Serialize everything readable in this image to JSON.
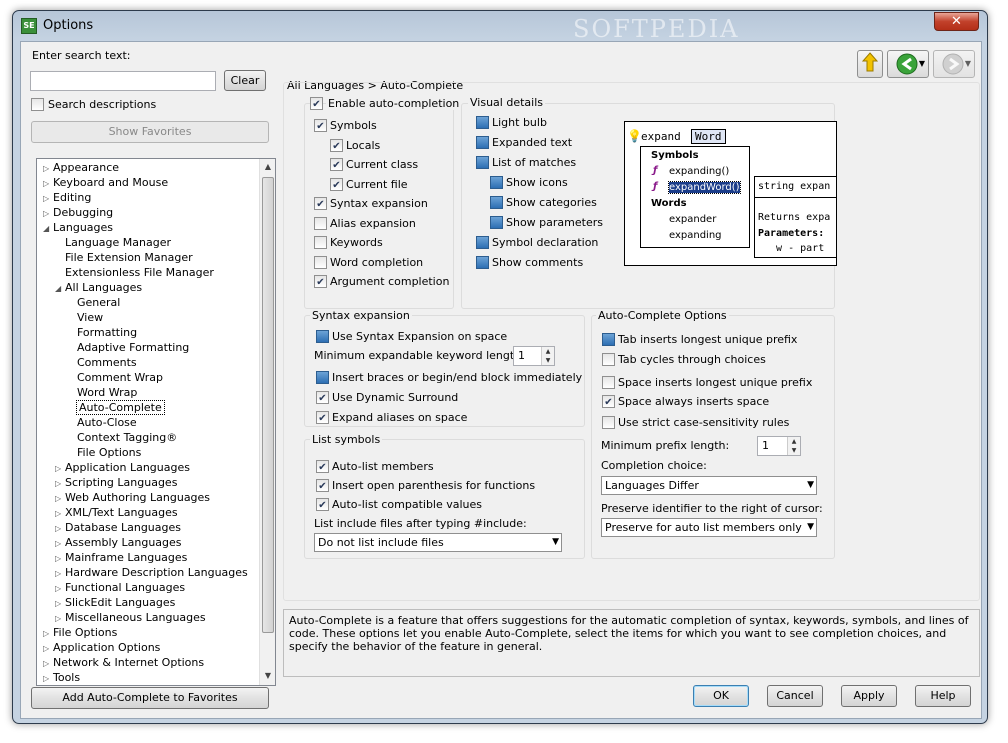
{
  "window": {
    "title": "Options",
    "app_icon": "SE",
    "watermark": "SOFTPEDIA",
    "close_glyph": "✕"
  },
  "left": {
    "search_label": "Enter search text:",
    "search_value": "",
    "clear_label": "Clear",
    "search_desc_label": "Search descriptions",
    "show_favorites_label": "Show Favorites",
    "add_favorites_label": "Add Auto-Complete to Favorites"
  },
  "tree": [
    {
      "label": "Appearance",
      "indent": 0,
      "twisty": "▷"
    },
    {
      "label": "Keyboard and Mouse",
      "indent": 0,
      "twisty": "▷"
    },
    {
      "label": "Editing",
      "indent": 0,
      "twisty": "▷"
    },
    {
      "label": "Debugging",
      "indent": 0,
      "twisty": "▷"
    },
    {
      "label": "Languages",
      "indent": 0,
      "twisty": "◢"
    },
    {
      "label": "Language Manager",
      "indent": 1,
      "twisty": ""
    },
    {
      "label": "File Extension Manager",
      "indent": 1,
      "twisty": ""
    },
    {
      "label": "Extensionless File Manager",
      "indent": 1,
      "twisty": ""
    },
    {
      "label": "All Languages",
      "indent": 1,
      "twisty": "◢"
    },
    {
      "label": "General",
      "indent": 2,
      "twisty": ""
    },
    {
      "label": "View",
      "indent": 2,
      "twisty": ""
    },
    {
      "label": "Formatting",
      "indent": 2,
      "twisty": ""
    },
    {
      "label": "Adaptive Formatting",
      "indent": 2,
      "twisty": ""
    },
    {
      "label": "Comments",
      "indent": 2,
      "twisty": ""
    },
    {
      "label": "Comment Wrap",
      "indent": 2,
      "twisty": ""
    },
    {
      "label": "Word Wrap",
      "indent": 2,
      "twisty": ""
    },
    {
      "label": "Auto-Complete",
      "indent": 2,
      "twisty": "",
      "selected": true
    },
    {
      "label": "Auto-Close",
      "indent": 2,
      "twisty": ""
    },
    {
      "label": "Context Tagging®",
      "indent": 2,
      "twisty": ""
    },
    {
      "label": "File Options",
      "indent": 2,
      "twisty": ""
    },
    {
      "label": "Application Languages",
      "indent": 1,
      "twisty": "▷"
    },
    {
      "label": "Scripting Languages",
      "indent": 1,
      "twisty": "▷"
    },
    {
      "label": "Web Authoring Languages",
      "indent": 1,
      "twisty": "▷"
    },
    {
      "label": "XML/Text Languages",
      "indent": 1,
      "twisty": "▷"
    },
    {
      "label": "Database Languages",
      "indent": 1,
      "twisty": "▷"
    },
    {
      "label": "Assembly Languages",
      "indent": 1,
      "twisty": "▷"
    },
    {
      "label": "Mainframe Languages",
      "indent": 1,
      "twisty": "▷"
    },
    {
      "label": "Hardware Description Languages",
      "indent": 1,
      "twisty": "▷"
    },
    {
      "label": "Functional Languages",
      "indent": 1,
      "twisty": "▷"
    },
    {
      "label": "SlickEdit Languages",
      "indent": 1,
      "twisty": "▷"
    },
    {
      "label": "Miscellaneous Languages",
      "indent": 1,
      "twisty": "▷"
    },
    {
      "label": "File Options",
      "indent": 0,
      "twisty": "▷"
    },
    {
      "label": "Application Options",
      "indent": 0,
      "twisty": "▷"
    },
    {
      "label": "Network & Internet Options",
      "indent": 0,
      "twisty": "▷"
    },
    {
      "label": "Tools",
      "indent": 0,
      "twisty": "▷"
    }
  ],
  "breadcrumb": "All Languages > Auto-Complete",
  "enable": {
    "label": "Enable auto-completion",
    "checked": true
  },
  "enable_items": [
    {
      "label": "Symbols",
      "checked": true,
      "indent": 0
    },
    {
      "label": "Locals",
      "checked": true,
      "indent": 1
    },
    {
      "label": "Current class",
      "checked": true,
      "indent": 1
    },
    {
      "label": "Current file",
      "checked": true,
      "indent": 1
    },
    {
      "label": "Syntax expansion",
      "checked": true,
      "indent": 0
    },
    {
      "label": "Alias expansion",
      "checked": false,
      "indent": 0
    },
    {
      "label": "Keywords",
      "checked": false,
      "indent": 0
    },
    {
      "label": "Word completion",
      "checked": false,
      "indent": 0
    },
    {
      "label": "Argument completion",
      "checked": true,
      "indent": 0
    }
  ],
  "visual": {
    "title": "Visual details",
    "items": [
      {
        "label": "Light bulb",
        "indent": 0
      },
      {
        "label": "Expanded text",
        "indent": 0
      },
      {
        "label": "List of matches",
        "indent": 0
      },
      {
        "label": "Show icons",
        "indent": 1
      },
      {
        "label": "Show categories",
        "indent": 1
      },
      {
        "label": "Show parameters",
        "indent": 1
      },
      {
        "label": "Symbol declaration",
        "indent": 0
      },
      {
        "label": "Show comments",
        "indent": 0
      }
    ]
  },
  "preview": {
    "typed": "expand",
    "completion": "Word",
    "list": [
      "Symbols",
      "expanding()",
      "expandWord()",
      "Words",
      "expander",
      "expanding"
    ],
    "tooltip_lines": [
      "string expan",
      "Returns expa",
      "Parameters:",
      "   w - part"
    ]
  },
  "syntax": {
    "title": "Syntax expansion",
    "use_on_space": "Use Syntax Expansion on space",
    "min_len_label": "Minimum expandable keyword length:",
    "min_len_value": "1",
    "braces": "Insert braces or begin/end block immediately",
    "dynamic": "Use Dynamic Surround",
    "aliases": "Expand aliases on space"
  },
  "listsym": {
    "title": "List symbols",
    "auto_list": "Auto-list members",
    "insert_paren": "Insert open parenthesis for functions",
    "compat": "Auto-list compatible values",
    "include_label": "List include files after typing #include:",
    "include_value": "Do not list include files"
  },
  "options": {
    "title": "Auto-Complete Options",
    "tab_inserts": "Tab inserts longest unique prefix",
    "tab_cycles": "Tab cycles through choices",
    "space_inserts": "Space inserts longest unique prefix",
    "space_always": "Space always inserts space",
    "strict_case": "Use strict case-sensitivity rules",
    "min_prefix_label": "Minimum prefix length:",
    "min_prefix_value": "1",
    "completion_choice_label": "Completion choice:",
    "completion_choice_value": "Languages Differ",
    "preserve_label": "Preserve identifier to the right of cursor:",
    "preserve_value": "Preserve for auto list members only"
  },
  "description": "Auto-Complete is a feature that offers suggestions for the automatic completion of syntax, keywords, symbols, and lines of code. These options let you enable Auto-Complete, select the items for which you want to see completion choices, and specify the behavior of the feature in general.",
  "buttons": {
    "ok": "OK",
    "cancel": "Cancel",
    "apply": "Apply",
    "help": "Help"
  }
}
